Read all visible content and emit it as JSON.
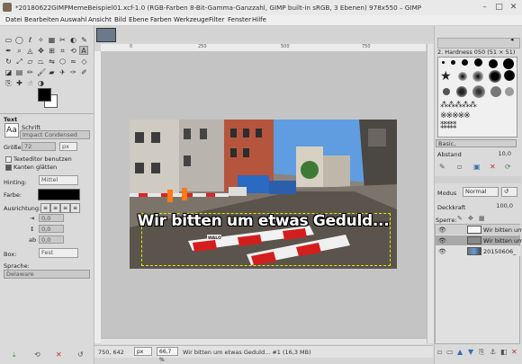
{
  "window": {
    "title": "*20180622GIMPMemeBeispiel01.xcf-1.0 (RGB-Farben 8-Bit-Gamma-Ganzzahl, GIMP built-in sRGB, 3 Ebenen) 978x550 – GIMP"
  },
  "menu": [
    "Datei",
    "Bearbeiten",
    "Auswahl",
    "Ansicht",
    "Bild",
    "Ebene",
    "Farben",
    "Werkzeuge",
    "Filter",
    "Fenster",
    "Hilfe"
  ],
  "tool_options": {
    "section": "Text",
    "font_label": "Schrift",
    "font_value": "Impact Condensed",
    "size_label": "Größe:",
    "size_value": "72",
    "size_unit": "px",
    "editor_checkbox": "Texteditor benutzen",
    "antialias_checkbox": "Kanten glätten",
    "hinting_label": "Hinting:",
    "hinting_value": "Mittel",
    "color_label": "Farbe:",
    "justify_label": "Ausrichtung:",
    "indent_value": "0,0",
    "linespacing_value": "0,0",
    "letterspacing_value": "0,0",
    "box_label": "Box:",
    "box_value": "Fest",
    "language_label": "Sprache:",
    "language_value": "Delaware"
  },
  "canvas": {
    "meme_text": "Wir bitten um etwas Geduld...",
    "road_sign": "WALO",
    "ruler_ticks": [
      "0",
      "250",
      "500",
      "750"
    ]
  },
  "status": {
    "coords": "750, 642",
    "unit": "px",
    "zoom": "66,7 %",
    "info": "Wir bitten um etwas Geduld... #1 (16,3 MB)"
  },
  "brushes": {
    "current": "2. Hardness 050 (51 × 51)",
    "preset": "Basic,",
    "spacing_label": "Abstand",
    "spacing_value": "10,0"
  },
  "layers": {
    "mode_label": "Modus",
    "mode_value": "Normal",
    "opacity_label": "Deckkraft",
    "opacity_value": "100,0",
    "lock_label": "Sperre:",
    "items": [
      {
        "name": "Wir bitten um"
      },
      {
        "name": "Wir bitten um"
      },
      {
        "name": "20150606_"
      }
    ]
  },
  "colors": {
    "selected_layer": "#a8a8a8",
    "selection_outline": "#e8e800",
    "fg": "#000000",
    "bg": "#ffffff"
  }
}
